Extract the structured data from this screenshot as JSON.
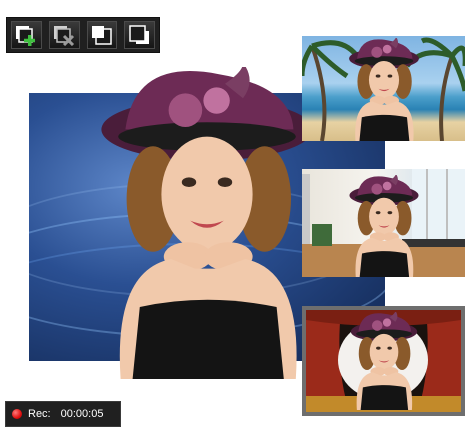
{
  "toolbar": {
    "buttons": [
      {
        "name": "add-layer-button",
        "icon": "add-layer-icon"
      },
      {
        "name": "remove-layer-button",
        "icon": "remove-layer-icon"
      },
      {
        "name": "bring-to-front-button",
        "icon": "bring-to-front-icon"
      },
      {
        "name": "send-to-back-button",
        "icon": "send-to-back-icon"
      }
    ]
  },
  "preview": {
    "main_background": "blue-abstract-waves",
    "thumbnails": [
      {
        "name": "thumbnail-beach",
        "scene": "beach"
      },
      {
        "name": "thumbnail-office",
        "scene": "office"
      },
      {
        "name": "thumbnail-stage",
        "scene": "theater-stage"
      }
    ]
  },
  "status": {
    "rec_label": "Rec:",
    "time": "00:00:05"
  },
  "colors": {
    "toolbar_bg": "#202020",
    "rec_dot": "#e01010",
    "add_icon": "#3fbf3f"
  }
}
